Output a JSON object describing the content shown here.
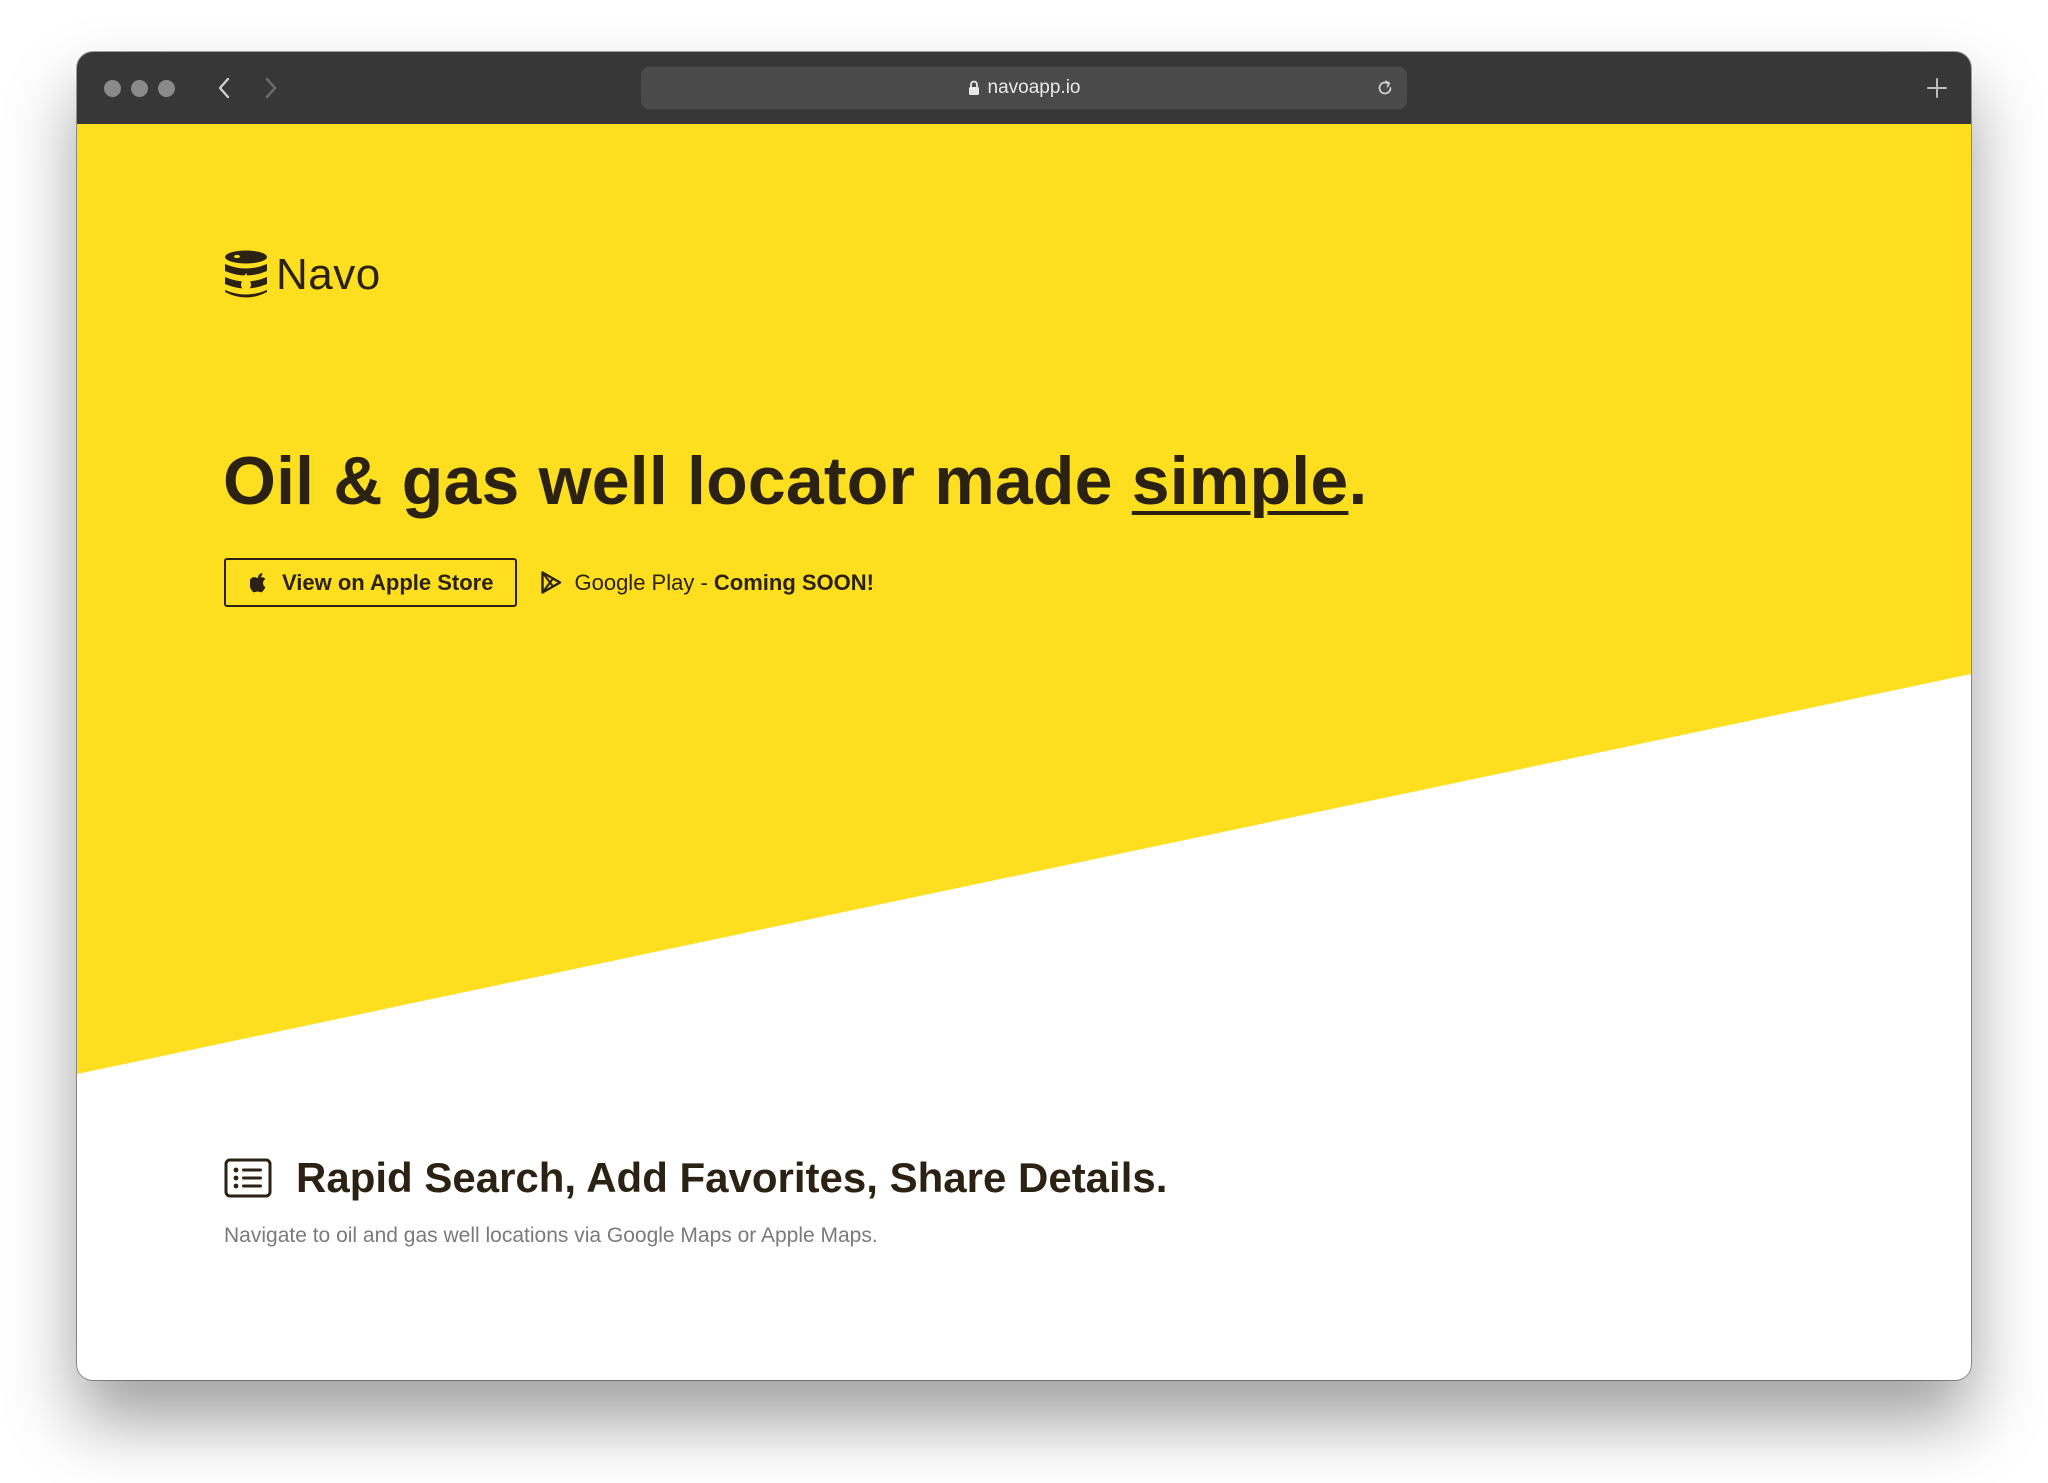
{
  "browser": {
    "url": "navoapp.io"
  },
  "colors": {
    "hero_yellow": "#FEDF1F",
    "ink": "#2B2213",
    "muted_text": "#7A7A7A",
    "toolbar": "#373737"
  },
  "brand": {
    "name": "Navo",
    "logo_icon": "oil-barrel-icon"
  },
  "hero": {
    "headline_prefix": "Oil & gas well locator made ",
    "headline_emphasis": "simple",
    "headline_suffix": ".",
    "apple_button_label": "View on Apple Store",
    "apple_icon": "apple-icon",
    "play_icon": "google-play-icon",
    "play_label": "Google Play - ",
    "play_status": "Coming SOON!"
  },
  "features": {
    "icon": "list-icon",
    "title": "Rapid Search, Add Favorites, Share Details.",
    "subtitle": "Navigate to oil and gas well locations via Google Maps or Apple Maps."
  }
}
